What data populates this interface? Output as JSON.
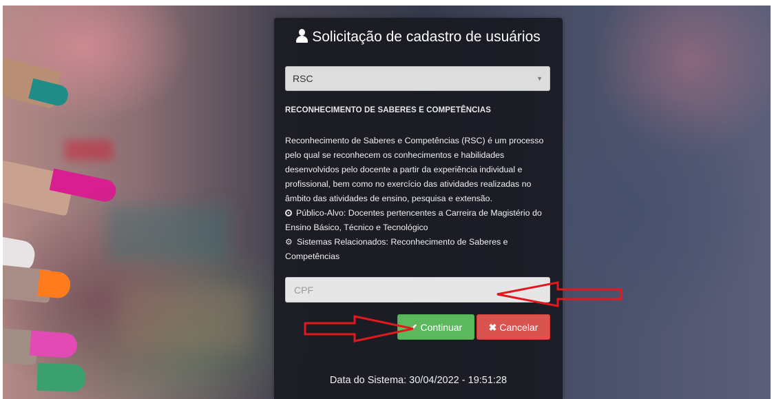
{
  "title": "Solicitação de cadastro de usuários",
  "select": {
    "value": "RSC"
  },
  "section_heading": "RECONHECIMENTO DE SABERES E COMPETÊNCIAS",
  "description": {
    "text": "Reconhecimento de Saberes e Competências (RSC) é um processo pelo qual se reconhecem os conhecimentos e habilidades desenvolvidos pelo docente a partir da experiência individual e profissional, bem como no exercício das atividades realizadas no âmbito das atividades de ensino, pesquisa e extensão.",
    "target_audience": "Público-Alvo: Docentes pertencentes a Carreira de Magistério do Ensino Básico, Técnico e Tecnológico",
    "related_systems": "Sistemas Relacionados: Reconhecimento de Saberes e Competências"
  },
  "cpf_input": {
    "placeholder": "CPF",
    "value": ""
  },
  "buttons": {
    "continue": "Continuar",
    "cancel": "Cancelar"
  },
  "footer": {
    "system_date": "Data do Sistema: 30/04/2022 - 19:51:28"
  },
  "icons": {
    "title": "user-icon",
    "target": "dot-circle-icon",
    "related": "cogs-icon",
    "continue": "check-icon",
    "cancel": "times-icon"
  },
  "colors": {
    "card_background": "#1a1b21",
    "continue_button": "#5cb85c",
    "cancel_button": "#d9534f",
    "annotation_arrow": "#e0191f"
  }
}
